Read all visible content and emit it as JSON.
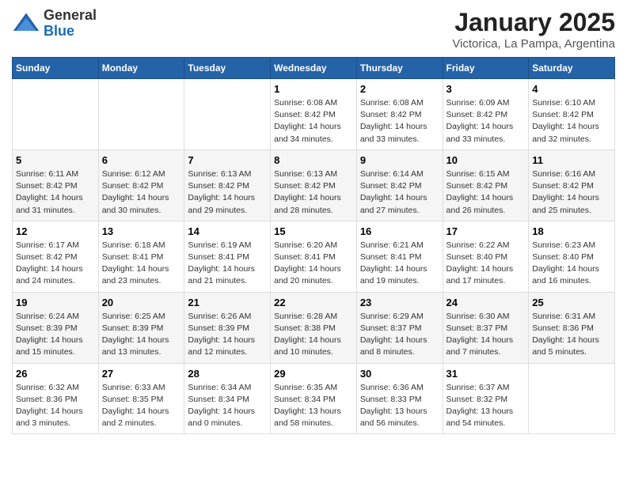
{
  "header": {
    "logo": {
      "general": "General",
      "blue": "Blue"
    },
    "title": "January 2025",
    "subtitle": "Victorica, La Pampa, Argentina"
  },
  "days_of_week": [
    "Sunday",
    "Monday",
    "Tuesday",
    "Wednesday",
    "Thursday",
    "Friday",
    "Saturday"
  ],
  "weeks": [
    [
      {
        "day": "",
        "info": ""
      },
      {
        "day": "",
        "info": ""
      },
      {
        "day": "",
        "info": ""
      },
      {
        "day": "1",
        "info": "Sunrise: 6:08 AM\nSunset: 8:42 PM\nDaylight: 14 hours\nand 34 minutes."
      },
      {
        "day": "2",
        "info": "Sunrise: 6:08 AM\nSunset: 8:42 PM\nDaylight: 14 hours\nand 33 minutes."
      },
      {
        "day": "3",
        "info": "Sunrise: 6:09 AM\nSunset: 8:42 PM\nDaylight: 14 hours\nand 33 minutes."
      },
      {
        "day": "4",
        "info": "Sunrise: 6:10 AM\nSunset: 8:42 PM\nDaylight: 14 hours\nand 32 minutes."
      }
    ],
    [
      {
        "day": "5",
        "info": "Sunrise: 6:11 AM\nSunset: 8:42 PM\nDaylight: 14 hours\nand 31 minutes."
      },
      {
        "day": "6",
        "info": "Sunrise: 6:12 AM\nSunset: 8:42 PM\nDaylight: 14 hours\nand 30 minutes."
      },
      {
        "day": "7",
        "info": "Sunrise: 6:13 AM\nSunset: 8:42 PM\nDaylight: 14 hours\nand 29 minutes."
      },
      {
        "day": "8",
        "info": "Sunrise: 6:13 AM\nSunset: 8:42 PM\nDaylight: 14 hours\nand 28 minutes."
      },
      {
        "day": "9",
        "info": "Sunrise: 6:14 AM\nSunset: 8:42 PM\nDaylight: 14 hours\nand 27 minutes."
      },
      {
        "day": "10",
        "info": "Sunrise: 6:15 AM\nSunset: 8:42 PM\nDaylight: 14 hours\nand 26 minutes."
      },
      {
        "day": "11",
        "info": "Sunrise: 6:16 AM\nSunset: 8:42 PM\nDaylight: 14 hours\nand 25 minutes."
      }
    ],
    [
      {
        "day": "12",
        "info": "Sunrise: 6:17 AM\nSunset: 8:42 PM\nDaylight: 14 hours\nand 24 minutes."
      },
      {
        "day": "13",
        "info": "Sunrise: 6:18 AM\nSunset: 8:41 PM\nDaylight: 14 hours\nand 23 minutes."
      },
      {
        "day": "14",
        "info": "Sunrise: 6:19 AM\nSunset: 8:41 PM\nDaylight: 14 hours\nand 21 minutes."
      },
      {
        "day": "15",
        "info": "Sunrise: 6:20 AM\nSunset: 8:41 PM\nDaylight: 14 hours\nand 20 minutes."
      },
      {
        "day": "16",
        "info": "Sunrise: 6:21 AM\nSunset: 8:41 PM\nDaylight: 14 hours\nand 19 minutes."
      },
      {
        "day": "17",
        "info": "Sunrise: 6:22 AM\nSunset: 8:40 PM\nDaylight: 14 hours\nand 17 minutes."
      },
      {
        "day": "18",
        "info": "Sunrise: 6:23 AM\nSunset: 8:40 PM\nDaylight: 14 hours\nand 16 minutes."
      }
    ],
    [
      {
        "day": "19",
        "info": "Sunrise: 6:24 AM\nSunset: 8:39 PM\nDaylight: 14 hours\nand 15 minutes."
      },
      {
        "day": "20",
        "info": "Sunrise: 6:25 AM\nSunset: 8:39 PM\nDaylight: 14 hours\nand 13 minutes."
      },
      {
        "day": "21",
        "info": "Sunrise: 6:26 AM\nSunset: 8:39 PM\nDaylight: 14 hours\nand 12 minutes."
      },
      {
        "day": "22",
        "info": "Sunrise: 6:28 AM\nSunset: 8:38 PM\nDaylight: 14 hours\nand 10 minutes."
      },
      {
        "day": "23",
        "info": "Sunrise: 6:29 AM\nSunset: 8:37 PM\nDaylight: 14 hours\nand 8 minutes."
      },
      {
        "day": "24",
        "info": "Sunrise: 6:30 AM\nSunset: 8:37 PM\nDaylight: 14 hours\nand 7 minutes."
      },
      {
        "day": "25",
        "info": "Sunrise: 6:31 AM\nSunset: 8:36 PM\nDaylight: 14 hours\nand 5 minutes."
      }
    ],
    [
      {
        "day": "26",
        "info": "Sunrise: 6:32 AM\nSunset: 8:36 PM\nDaylight: 14 hours\nand 3 minutes."
      },
      {
        "day": "27",
        "info": "Sunrise: 6:33 AM\nSunset: 8:35 PM\nDaylight: 14 hours\nand 2 minutes."
      },
      {
        "day": "28",
        "info": "Sunrise: 6:34 AM\nSunset: 8:34 PM\nDaylight: 14 hours\nand 0 minutes."
      },
      {
        "day": "29",
        "info": "Sunrise: 6:35 AM\nSunset: 8:34 PM\nDaylight: 13 hours\nand 58 minutes."
      },
      {
        "day": "30",
        "info": "Sunrise: 6:36 AM\nSunset: 8:33 PM\nDaylight: 13 hours\nand 56 minutes."
      },
      {
        "day": "31",
        "info": "Sunrise: 6:37 AM\nSunset: 8:32 PM\nDaylight: 13 hours\nand 54 minutes."
      },
      {
        "day": "",
        "info": ""
      }
    ]
  ]
}
